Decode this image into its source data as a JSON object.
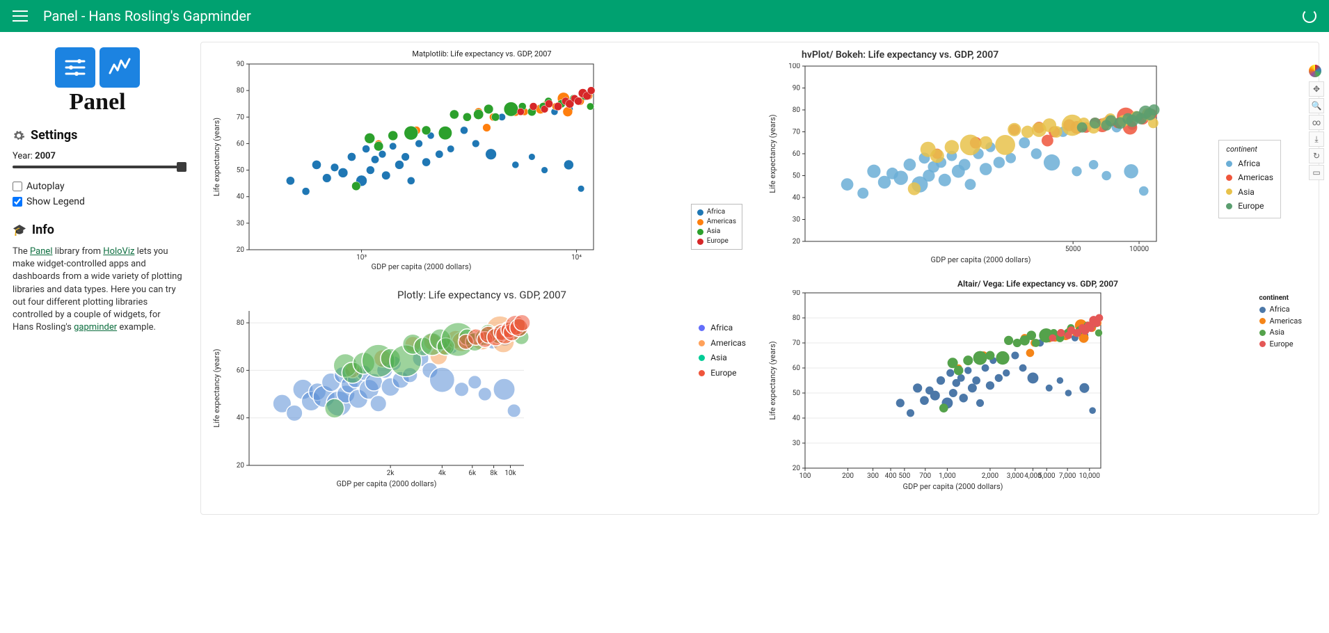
{
  "header": {
    "app_name": "Panel",
    "separator": "  -  ",
    "page_title": "Hans Rosling's Gapminder"
  },
  "sidebar": {
    "logo_word": "Panel",
    "settings_heading": "Settings",
    "year_label_prefix": "Year: ",
    "year_value": "2007",
    "autoplay_label": "Autoplay",
    "autoplay_checked": false,
    "showlegend_label": "Show Legend",
    "showlegend_checked": true,
    "info_heading": "Info",
    "info_text_1": "The ",
    "info_link_panel": "Panel",
    "info_text_2": " library from ",
    "info_link_holoviz": "HoloViz",
    "info_text_3": " lets you make widget-controlled apps and dashboards from a wide variety of plotting libraries and data types. Here you can try out four different plotting libraries controlled by a couple of widgets, for Hans Rosling's ",
    "info_link_gapminder": "gapminder",
    "info_text_4": " example."
  },
  "legend": {
    "title": "continent",
    "items": [
      {
        "name": "Africa",
        "mpl": "#1f77b4",
        "plotly": "#636efa",
        "bokeh": "#6baed6",
        "altair": "#4c78a8"
      },
      {
        "name": "Americas",
        "mpl": "#ff7f0e",
        "plotly": "#ffa15a",
        "bokeh": "#ef553b",
        "altair": "#f58518"
      },
      {
        "name": "Asia",
        "mpl": "#2ca02c",
        "plotly": "#00cc96",
        "bokeh": "#e8c24b",
        "altair": "#54a24b"
      },
      {
        "name": "Europe",
        "mpl": "#d62728",
        "plotly": "#ef553b",
        "bokeh": "#5a9e6f",
        "altair": "#e45756"
      }
    ]
  },
  "chart_data": [
    {
      "id": "mpl",
      "type": "scatter",
      "title": "Matplotlib: Life expectancy vs. GDP, 2007",
      "xlabel": "GDP per capita (2000 dollars)",
      "ylabel": "Life expectancy (years)",
      "xscale": "log",
      "xlim": [
        300,
        12000
      ],
      "ylim": [
        20,
        90
      ],
      "xticks_label": [
        "10³",
        "10⁴"
      ],
      "yticks": [
        20,
        30,
        40,
        50,
        60,
        70,
        80,
        90
      ]
    },
    {
      "id": "hvplot",
      "type": "scatter",
      "title": "hvPlot/ Bokeh: Life expectancy vs. GDP, 2007",
      "xlabel": "GDP per capita (2000 dollars)",
      "ylabel": "Life expectancy (years)",
      "xscale": "log",
      "xlim": [
        300,
        12000
      ],
      "ylim": [
        20,
        100
      ],
      "xticks_label": [
        "5000",
        "10000"
      ],
      "yticks": [
        20,
        30,
        40,
        50,
        60,
        70,
        80,
        90,
        100
      ],
      "legend_position": "right-inside"
    },
    {
      "id": "plotly",
      "type": "scatter",
      "title": "Plotly: Life expectancy vs. GDP, 2007",
      "xlabel": "GDP per capita (2000 dollars)",
      "ylabel": "Life expectancy (years)",
      "xscale": "log",
      "xlim": [
        300,
        12000
      ],
      "ylim": [
        20,
        85
      ],
      "xticks_label": [
        "2k",
        "4k",
        "6k",
        "8k",
        "10k"
      ],
      "yticks": [
        20,
        40,
        60,
        80
      ]
    },
    {
      "id": "altair",
      "type": "scatter",
      "title": "Altair/ Vega: Life expectancy vs. GDP, 2007",
      "xlabel": "GDP per capita (2000 dollars)",
      "ylabel": "Life expectancy (years)",
      "xscale": "log",
      "xlim": [
        100,
        12000
      ],
      "ylim": [
        20,
        90
      ],
      "xticks_label": [
        "100",
        "200",
        "300",
        "400",
        "500",
        "700",
        "1,000",
        "2,000",
        "3,000",
        "4,000",
        "5,000",
        "7,000",
        "10,000"
      ],
      "yticks": [
        20,
        30,
        40,
        50,
        60,
        70,
        80,
        90
      ]
    }
  ],
  "gapminder_2007": [
    {
      "c": "Africa",
      "g": 467,
      "l": 46,
      "p": 12
    },
    {
      "c": "Africa",
      "g": 551,
      "l": 42,
      "p": 8
    },
    {
      "c": "Africa",
      "g": 618,
      "l": 52,
      "p": 16
    },
    {
      "c": "Africa",
      "g": 690,
      "l": 47,
      "p": 14
    },
    {
      "c": "Africa",
      "g": 750,
      "l": 51,
      "p": 10
    },
    {
      "c": "Africa",
      "g": 820,
      "l": 49,
      "p": 20
    },
    {
      "c": "Africa",
      "g": 900,
      "l": 55,
      "p": 12
    },
    {
      "c": "Africa",
      "g": 1000,
      "l": 46,
      "p": 30
    },
    {
      "c": "Africa",
      "g": 1050,
      "l": 58,
      "p": 8
    },
    {
      "c": "Africa",
      "g": 1100,
      "l": 50,
      "p": 11
    },
    {
      "c": "Africa",
      "g": 1156,
      "l": 54,
      "p": 9
    },
    {
      "c": "Africa",
      "g": 1250,
      "l": 56,
      "p": 7
    },
    {
      "c": "Africa",
      "g": 1300,
      "l": 48,
      "p": 13
    },
    {
      "c": "Africa",
      "g": 1400,
      "l": 59,
      "p": 6
    },
    {
      "c": "Africa",
      "g": 1500,
      "l": 52,
      "p": 15
    },
    {
      "c": "Africa",
      "g": 1600,
      "l": 55,
      "p": 10
    },
    {
      "c": "Africa",
      "g": 1700,
      "l": 46,
      "p": 8
    },
    {
      "c": "Africa",
      "g": 1850,
      "l": 60,
      "p": 7
    },
    {
      "c": "Africa",
      "g": 2000,
      "l": 53,
      "p": 12
    },
    {
      "c": "Africa",
      "g": 2100,
      "l": 63,
      "p": 5
    },
    {
      "c": "Africa",
      "g": 2300,
      "l": 56,
      "p": 9
    },
    {
      "c": "Africa",
      "g": 2600,
      "l": 58,
      "p": 6
    },
    {
      "c": "Africa",
      "g": 3000,
      "l": 65,
      "p": 8
    },
    {
      "c": "Africa",
      "g": 3400,
      "l": 60,
      "p": 7
    },
    {
      "c": "Africa",
      "g": 4000,
      "l": 56,
      "p": 30
    },
    {
      "c": "Africa",
      "g": 4500,
      "l": 70,
      "p": 6
    },
    {
      "c": "Africa",
      "g": 5200,
      "l": 52,
      "p": 5
    },
    {
      "c": "Africa",
      "g": 6200,
      "l": 55,
      "p": 4
    },
    {
      "c": "Africa",
      "g": 7100,
      "l": 50,
      "p": 4
    },
    {
      "c": "Africa",
      "g": 7900,
      "l": 72,
      "p": 5
    },
    {
      "c": "Africa",
      "g": 9200,
      "l": 52,
      "p": 20
    },
    {
      "c": "Africa",
      "g": 9300,
      "l": 73,
      "p": 4
    },
    {
      "c": "Africa",
      "g": 10500,
      "l": 43,
      "p": 4
    },
    {
      "c": "Americas",
      "g": 1200,
      "l": 60,
      "p": 6
    },
    {
      "c": "Americas",
      "g": 1800,
      "l": 65,
      "p": 10
    },
    {
      "c": "Americas",
      "g": 2700,
      "l": 71,
      "p": 7
    },
    {
      "c": "Americas",
      "g": 3500,
      "l": 72,
      "p": 9
    },
    {
      "c": "Americas",
      "g": 3822,
      "l": 66,
      "p": 10
    },
    {
      "c": "Americas",
      "g": 4100,
      "l": 70,
      "p": 8
    },
    {
      "c": "Americas",
      "g": 4800,
      "l": 73,
      "p": 11
    },
    {
      "c": "Americas",
      "g": 5200,
      "l": 72,
      "p": 14
    },
    {
      "c": "Americas",
      "g": 5728,
      "l": 72,
      "p": 7
    },
    {
      "c": "Americas",
      "g": 6300,
      "l": 74,
      "p": 8
    },
    {
      "c": "Americas",
      "g": 6800,
      "l": 73,
      "p": 18
    },
    {
      "c": "Americas",
      "g": 7300,
      "l": 75,
      "p": 9
    },
    {
      "c": "Americas",
      "g": 8000,
      "l": 74,
      "p": 6
    },
    {
      "c": "Americas",
      "g": 8700,
      "l": 77,
      "p": 40
    },
    {
      "c": "Americas",
      "g": 9100,
      "l": 72,
      "p": 20
    },
    {
      "c": "Americas",
      "g": 10400,
      "l": 76,
      "p": 10
    },
    {
      "c": "Americas",
      "g": 11400,
      "l": 78,
      "p": 8
    },
    {
      "c": "Asia",
      "g": 944,
      "l": 44,
      "p": 14
    },
    {
      "c": "Asia",
      "g": 1091,
      "l": 62,
      "p": 25
    },
    {
      "c": "Asia",
      "g": 1201,
      "l": 59,
      "p": 18
    },
    {
      "c": "Asia",
      "g": 1400,
      "l": 63,
      "p": 20
    },
    {
      "c": "Asia",
      "g": 1700,
      "l": 64,
      "p": 60
    },
    {
      "c": "Asia",
      "g": 2000,
      "l": 65,
      "p": 15
    },
    {
      "c": "Asia",
      "g": 2452,
      "l": 64,
      "p": 55
    },
    {
      "c": "Asia",
      "g": 2700,
      "l": 71,
      "p": 16
    },
    {
      "c": "Asia",
      "g": 3100,
      "l": 70,
      "p": 12
    },
    {
      "c": "Asia",
      "g": 3500,
      "l": 71,
      "p": 22
    },
    {
      "c": "Asia",
      "g": 3900,
      "l": 73,
      "p": 18
    },
    {
      "c": "Asia",
      "g": 4200,
      "l": 70,
      "p": 10
    },
    {
      "c": "Asia",
      "g": 4959,
      "l": 73,
      "p": 65
    },
    {
      "c": "Asia",
      "g": 5600,
      "l": 74,
      "p": 8
    },
    {
      "c": "Asia",
      "g": 6200,
      "l": 72,
      "p": 12
    },
    {
      "c": "Asia",
      "g": 7000,
      "l": 74,
      "p": 9
    },
    {
      "c": "Asia",
      "g": 7400,
      "l": 76,
      "p": 7
    },
    {
      "c": "Asia",
      "g": 8500,
      "l": 75,
      "p": 10
    },
    {
      "c": "Asia",
      "g": 9700,
      "l": 77,
      "p": 8
    },
    {
      "c": "Asia",
      "g": 11000,
      "l": 78,
      "p": 14
    },
    {
      "c": "Asia",
      "g": 11600,
      "l": 74,
      "p": 6
    },
    {
      "c": "Europe",
      "g": 5500,
      "l": 72,
      "p": 6
    },
    {
      "c": "Europe",
      "g": 6300,
      "l": 74,
      "p": 8
    },
    {
      "c": "Europe",
      "g": 7100,
      "l": 73,
      "p": 7
    },
    {
      "c": "Europe",
      "g": 7446,
      "l": 75,
      "p": 9
    },
    {
      "c": "Europe",
      "g": 8200,
      "l": 74,
      "p": 10
    },
    {
      "c": "Europe",
      "g": 8900,
      "l": 76,
      "p": 8
    },
    {
      "c": "Europe",
      "g": 9300,
      "l": 75,
      "p": 12
    },
    {
      "c": "Europe",
      "g": 9800,
      "l": 77,
      "p": 7
    },
    {
      "c": "Europe",
      "g": 10200,
      "l": 76,
      "p": 9
    },
    {
      "c": "Europe",
      "g": 10700,
      "l": 79,
      "p": 15
    },
    {
      "c": "Europe",
      "g": 11200,
      "l": 78,
      "p": 11
    },
    {
      "c": "Europe",
      "g": 11700,
      "l": 80,
      "p": 8
    }
  ]
}
